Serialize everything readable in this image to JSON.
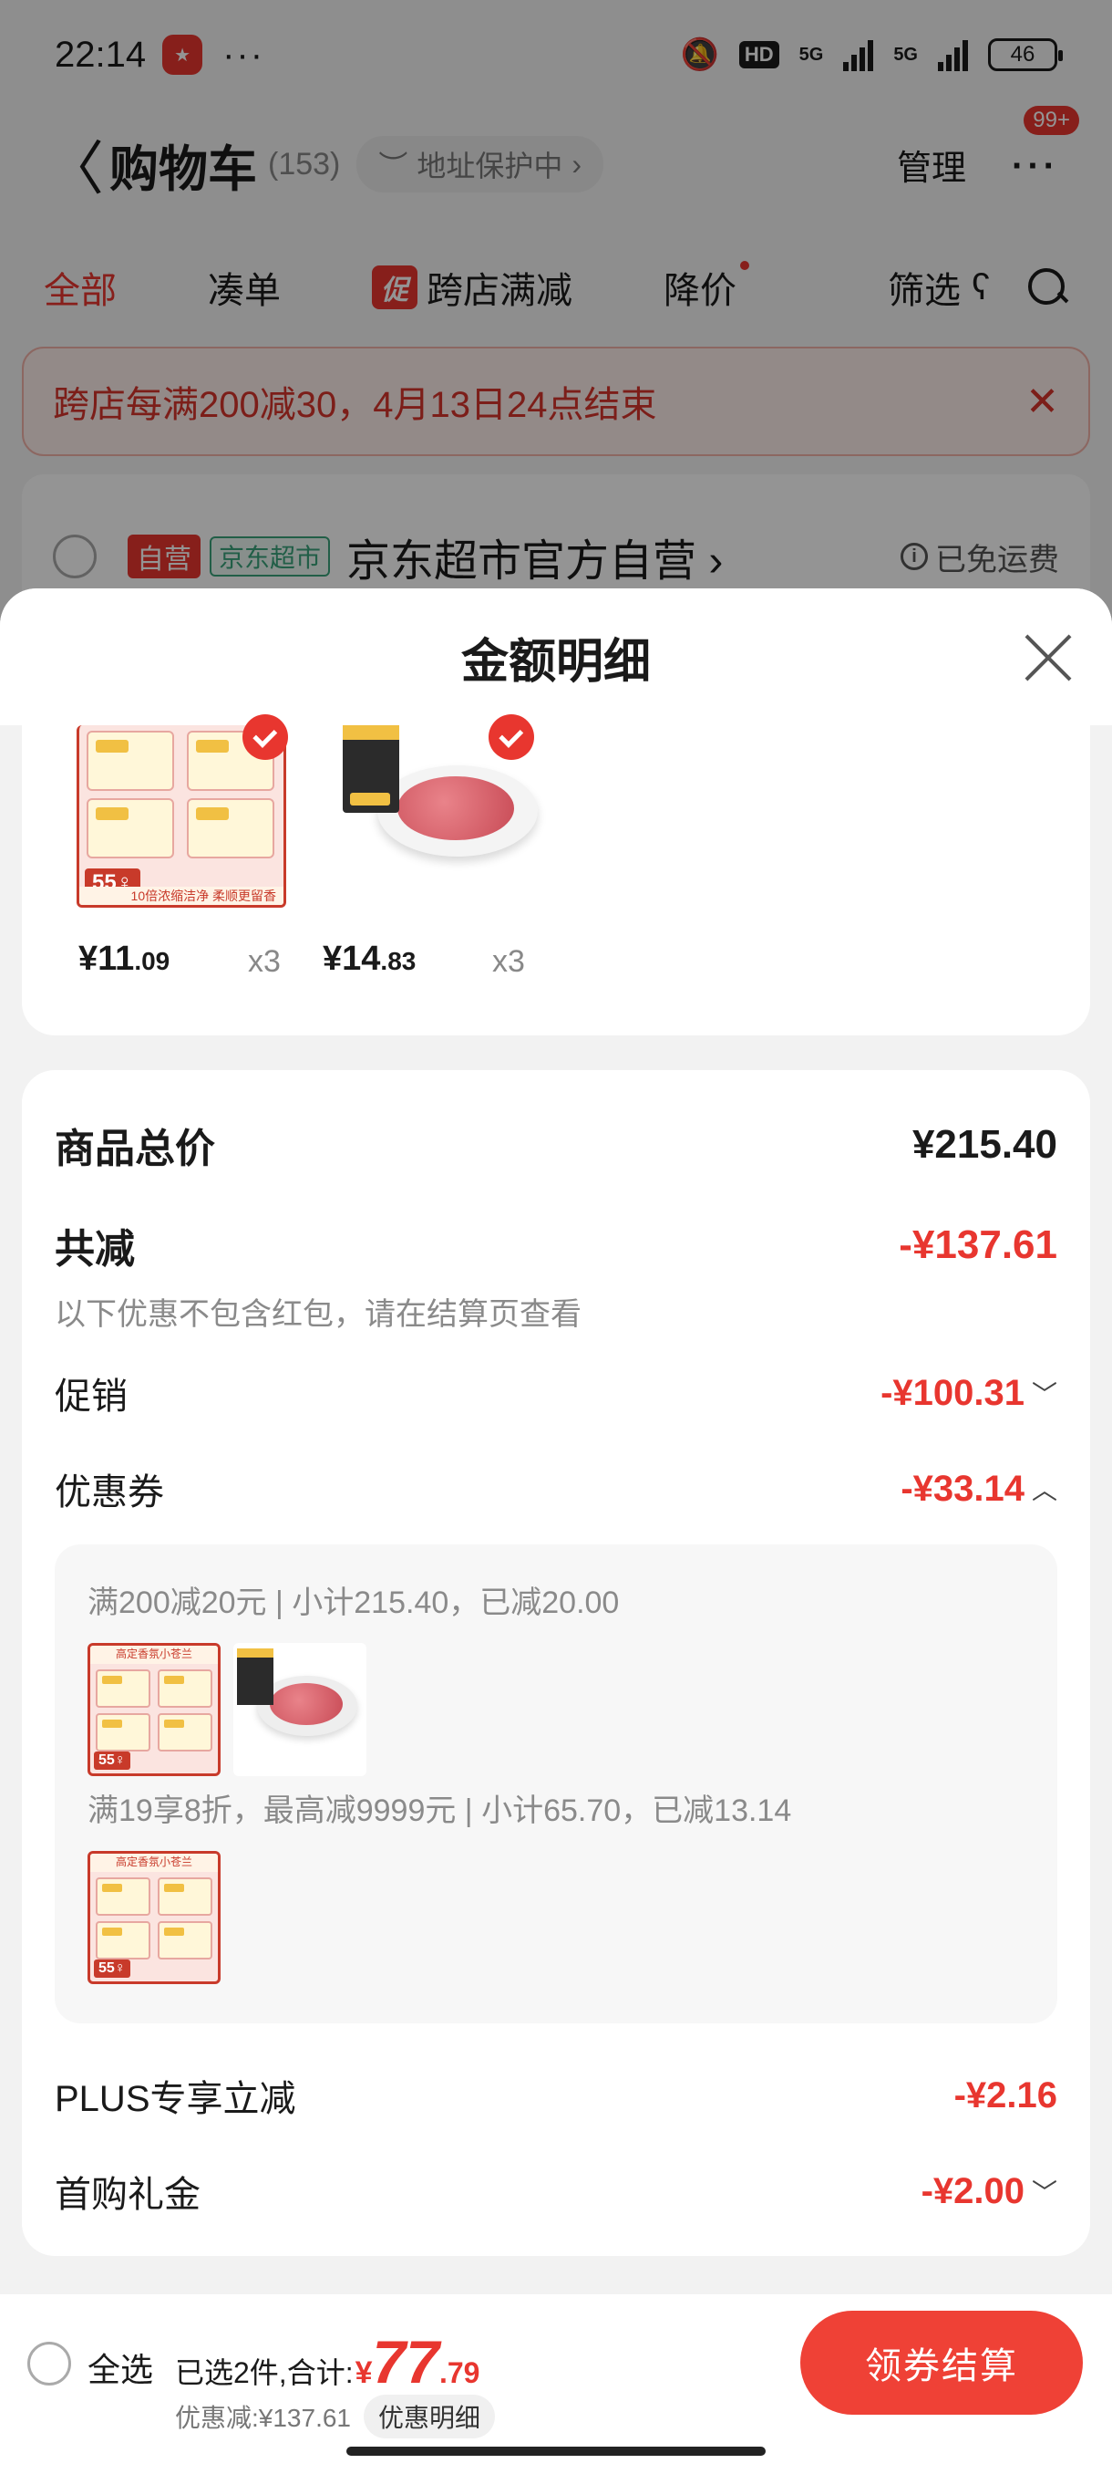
{
  "status_bar": {
    "time": "22:14",
    "more": "···",
    "hd": "HD",
    "net1": "5G",
    "net2": "5G",
    "battery": "46"
  },
  "nav": {
    "back": "〈",
    "title": "购物车",
    "count": "(153)",
    "address": "地址保护中",
    "manage": "管理",
    "more": "···",
    "badge": "99+"
  },
  "tabs": [
    {
      "label": "全部"
    },
    {
      "label": "凑单"
    },
    {
      "tag": "促",
      "label": "跨店满减"
    },
    {
      "label": "降价"
    }
  ],
  "filter": {
    "label": "筛选"
  },
  "banner": {
    "text": "跨店每满200减30，4月13日24点结束",
    "close": "✕"
  },
  "store": {
    "tag_self": "自营",
    "tag_mart": "京东超市",
    "name": "京东超市官方自营 ›",
    "shipping": "已免运费"
  },
  "sheet": {
    "title": "金额明细",
    "products": [
      {
        "yen": "¥",
        "int": "11",
        "dec": ".09",
        "qty": "x3",
        "label_55": "55♀",
        "strip": "10倍浓缩洁净 柔顺更留香"
      },
      {
        "yen": "¥",
        "int": "14",
        "dec": ".83",
        "qty": "x3"
      }
    ],
    "summary": {
      "total_label": "商品总价",
      "total_value": "¥215.40",
      "reduce_label": "共减",
      "reduce_value": "-¥137.61",
      "note": "以下优惠不包含红包，请在结算页查看",
      "promo_label": "促销",
      "promo_value": "-¥100.31",
      "coupon_label": "优惠券",
      "coupon_value": "-¥33.14",
      "coupon_lines": [
        "满200减20元 | 小计215.40，已减20.00",
        "满19享8折，最高减9999元 | 小计65.70，已减13.14"
      ],
      "thumb_top": "高定香氛小苍兰",
      "plus_label": "PLUS专享立减",
      "plus_value": "-¥2.16",
      "gift_label": "首购礼金",
      "gift_value": "-¥2.00"
    }
  },
  "bottom": {
    "select_all": "全选",
    "selected": "已选2件,合计:",
    "currency": "¥",
    "total_int": "77",
    "total_dec": ".79",
    "discount": "优惠减:¥137.61",
    "detail": "优惠明细",
    "button": "领券结算"
  },
  "colors": {
    "accent": "#e8362f",
    "button": "#ef4136"
  }
}
